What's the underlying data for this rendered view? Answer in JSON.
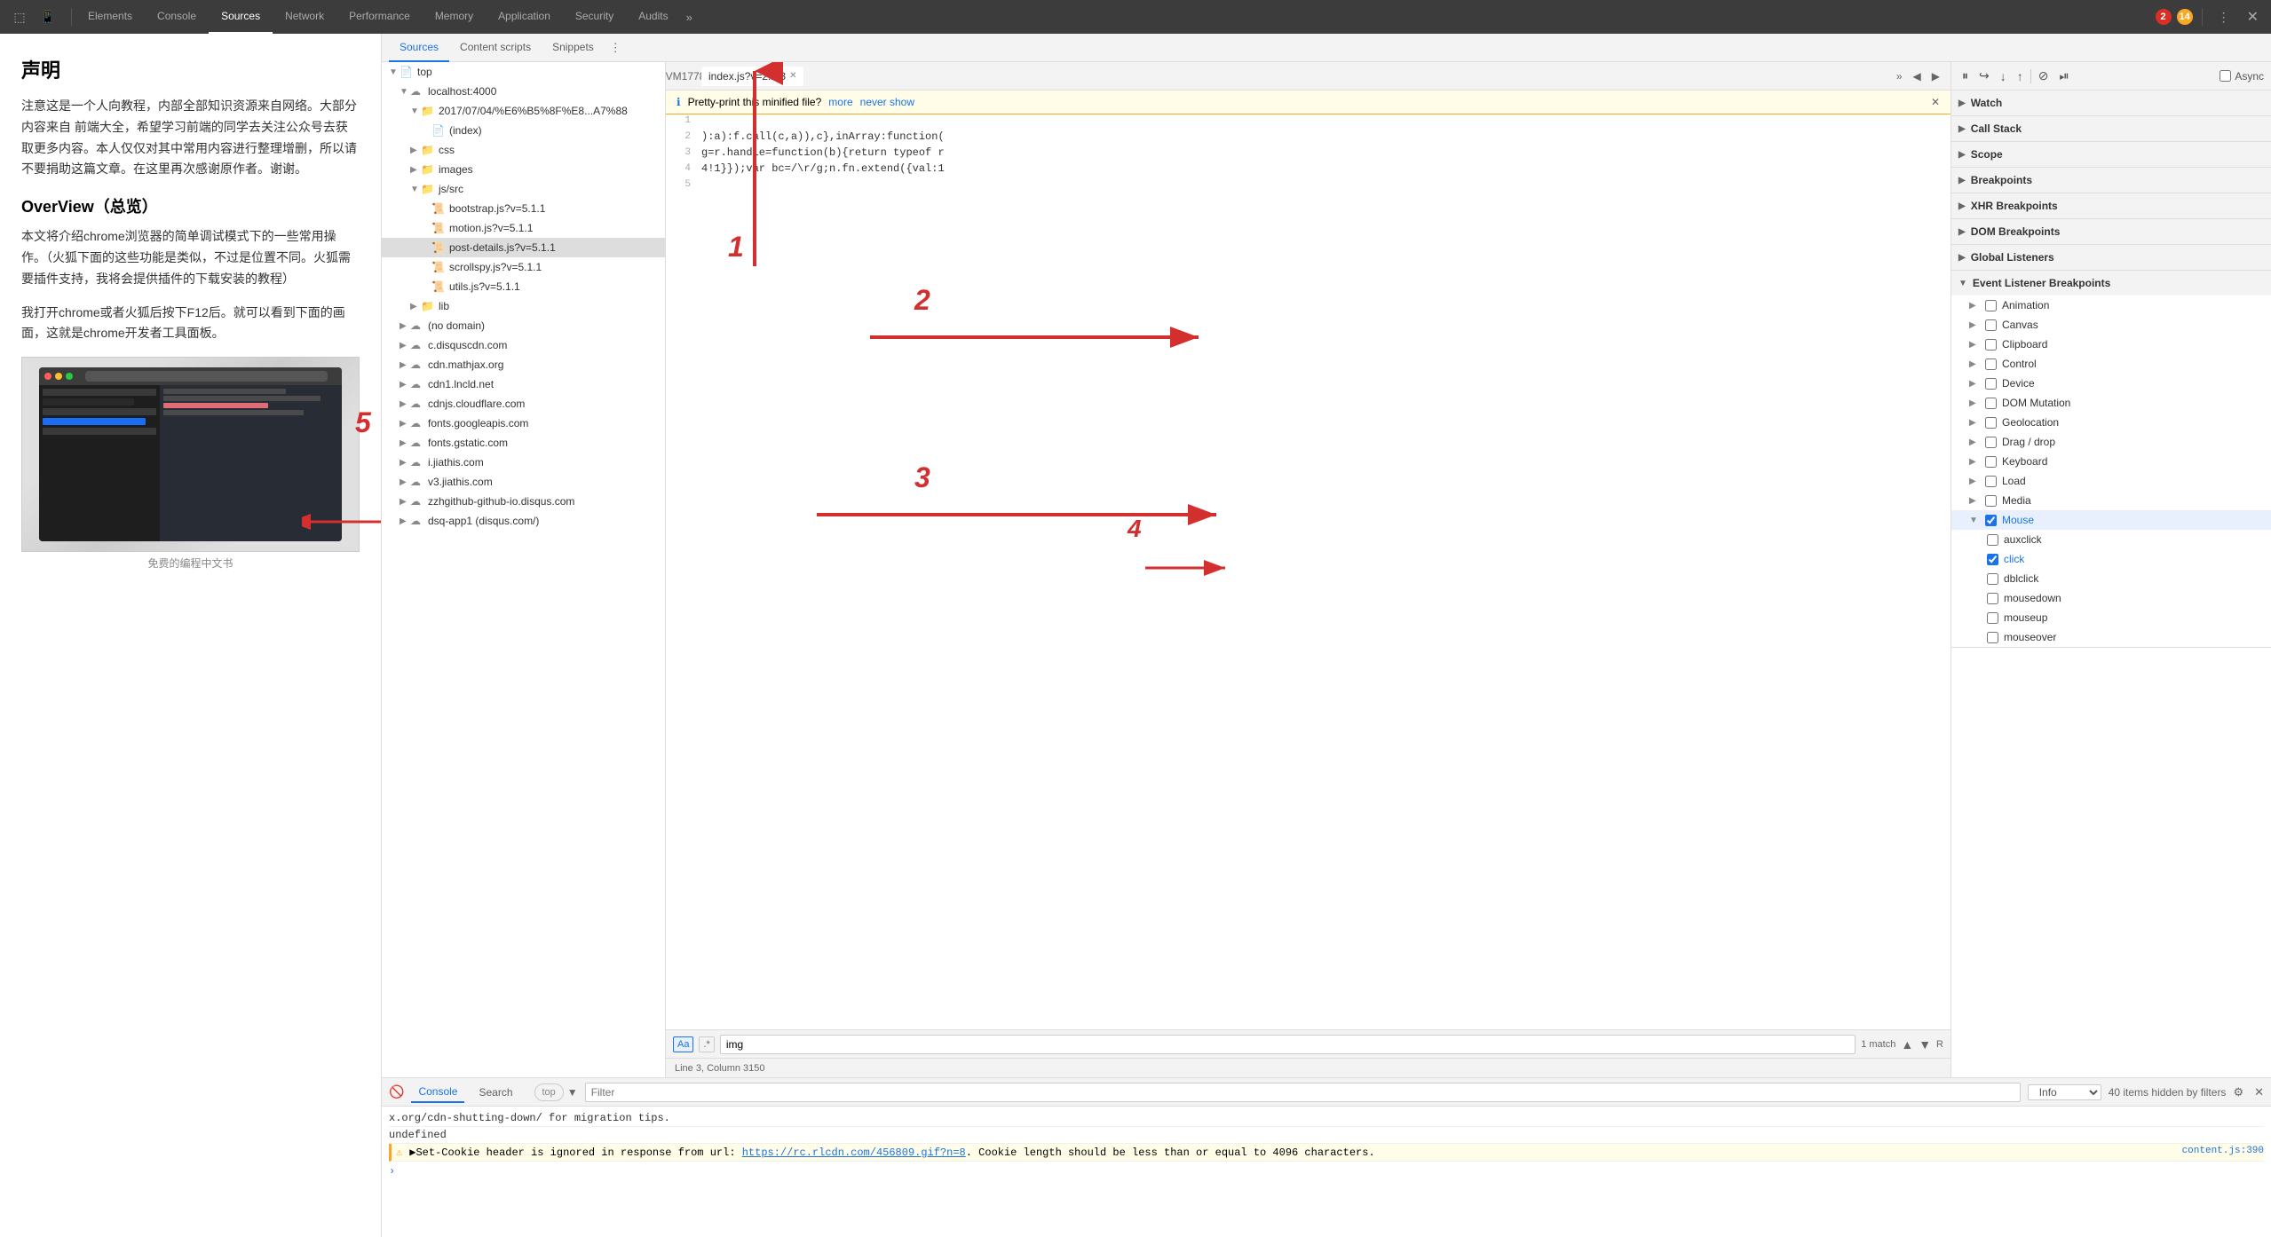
{
  "topbar": {
    "tabs": [
      {
        "label": "Elements",
        "active": false
      },
      {
        "label": "Console",
        "active": false
      },
      {
        "label": "Sources",
        "active": true
      },
      {
        "label": "Network",
        "active": false
      },
      {
        "label": "Performance",
        "active": false
      },
      {
        "label": "Memory",
        "active": false
      },
      {
        "label": "Application",
        "active": false
      },
      {
        "label": "Security",
        "active": false
      },
      {
        "label": "Audits",
        "active": false
      }
    ],
    "error_count": "2",
    "warning_count": "14",
    "more_label": "⋮"
  },
  "devtools_tabs": {
    "sources_tab": "Sources",
    "content_scripts_tab": "Content scripts",
    "snippets_tab": "Snippets",
    "more": "⋮"
  },
  "file_tree": {
    "root": "top",
    "items": [
      {
        "label": "top",
        "type": "root",
        "indent": 0,
        "expanded": true
      },
      {
        "label": "localhost:4000",
        "type": "cloud",
        "indent": 1,
        "expanded": true
      },
      {
        "label": "2017/07/04/%E6%B5%8F%E8...A7%88",
        "type": "folder",
        "indent": 2,
        "expanded": true
      },
      {
        "label": "(index)",
        "type": "file",
        "indent": 3,
        "expanded": false
      },
      {
        "label": "css",
        "type": "folder",
        "indent": 2,
        "expanded": false
      },
      {
        "label": "images",
        "type": "folder",
        "indent": 2,
        "expanded": false
      },
      {
        "label": "js/src",
        "type": "folder",
        "indent": 2,
        "expanded": true
      },
      {
        "label": "bootstrap.js?v=5.1.1",
        "type": "jsfile",
        "indent": 3,
        "expanded": false
      },
      {
        "label": "motion.js?v=5.1.1",
        "type": "jsfile",
        "indent": 3,
        "expanded": false
      },
      {
        "label": "post-details.js?v=5.1.1",
        "type": "jsfile",
        "indent": 3,
        "expanded": false,
        "selected": true
      },
      {
        "label": "scrollspy.js?v=5.1.1",
        "type": "jsfile",
        "indent": 3,
        "expanded": false
      },
      {
        "label": "utils.js?v=5.1.1",
        "type": "jsfile",
        "indent": 3,
        "expanded": false
      },
      {
        "label": "lib",
        "type": "folder",
        "indent": 2,
        "expanded": false
      },
      {
        "label": "(no domain)",
        "type": "cloud",
        "indent": 1,
        "expanded": false
      },
      {
        "label": "c.disquscdn.com",
        "type": "cloud",
        "indent": 1,
        "expanded": false
      },
      {
        "label": "cdn.mathjax.org",
        "type": "cloud",
        "indent": 1,
        "expanded": false
      },
      {
        "label": "cdn1.lncld.net",
        "type": "cloud",
        "indent": 1,
        "expanded": false
      },
      {
        "label": "cdnjs.cloudflare.com",
        "type": "cloud",
        "indent": 1,
        "expanded": false
      },
      {
        "label": "fonts.googleapis.com",
        "type": "cloud",
        "indent": 1,
        "expanded": false
      },
      {
        "label": "fonts.gstatic.com",
        "type": "cloud",
        "indent": 1,
        "expanded": false
      },
      {
        "label": "i.jiathis.com",
        "type": "cloud",
        "indent": 1,
        "expanded": false
      },
      {
        "label": "v3.jiathis.com",
        "type": "cloud",
        "indent": 1,
        "expanded": false
      },
      {
        "label": "zzhgithub-github-io.disqus.com",
        "type": "cloud",
        "indent": 1,
        "expanded": false
      },
      {
        "label": "dsq-app1 (disqus.com/)",
        "type": "cloud",
        "indent": 1,
        "expanded": false
      }
    ]
  },
  "code_panel": {
    "tab_label": "index.js?v=2.1.3",
    "pretty_print_msg": "Pretty-print this minified file?",
    "more_link": "more",
    "never_show_link": "never show",
    "lines": [
      {
        "num": "1",
        "content": ""
      },
      {
        "num": "2",
        "content": "):a):f.call(c,a)),c},inArray:function("
      },
      {
        "num": "3",
        "content": "g=r.handle=function(b){return typeof r"
      },
      {
        "num": "4",
        "content": "4!1}});var bc=/\\r/g;n.fn.extend({val:1"
      },
      {
        "num": "5",
        "content": ""
      }
    ],
    "search_placeholder": "img",
    "search_match": "1 match",
    "status": "Line 3, Column 3150"
  },
  "debugger": {
    "async_label": "Async",
    "sections": {
      "watch": "Watch",
      "call_stack": "Call Stack",
      "scope": "Scope",
      "breakpoints": "Breakpoints",
      "xhr_breakpoints": "XHR Breakpoints",
      "dom_breakpoints": "DOM Breakpoints",
      "global_listeners": "Global Listeners",
      "event_listener": "Event Listener Breakpoints"
    },
    "event_items": [
      {
        "label": "Animation",
        "checked": false,
        "expanded": false
      },
      {
        "label": "Canvas",
        "checked": false,
        "expanded": false
      },
      {
        "label": "Clipboard",
        "checked": false,
        "expanded": false
      },
      {
        "label": "Control",
        "checked": false,
        "expanded": false
      },
      {
        "label": "Device",
        "checked": false,
        "expanded": false
      },
      {
        "label": "DOM Mutation",
        "checked": false,
        "expanded": false
      },
      {
        "label": "Geolocation",
        "checked": false,
        "expanded": false
      },
      {
        "label": "Drag / drop",
        "checked": false,
        "expanded": false
      },
      {
        "label": "Keyboard",
        "checked": false,
        "expanded": false
      },
      {
        "label": "Load",
        "checked": false,
        "expanded": false
      },
      {
        "label": "Media",
        "checked": false,
        "expanded": false
      },
      {
        "label": "Mouse",
        "checked": false,
        "expanded": true,
        "blue": true
      }
    ],
    "mouse_sub_items": [
      {
        "label": "auxclick",
        "checked": false
      },
      {
        "label": "click",
        "checked": true
      },
      {
        "label": "dblclick",
        "checked": false
      },
      {
        "label": "mousedown",
        "checked": false
      },
      {
        "label": "mouseup",
        "checked": false
      },
      {
        "label": "mouseover",
        "checked": false
      }
    ]
  },
  "console": {
    "tabs": [
      {
        "label": "Console",
        "active": true
      },
      {
        "label": "Search",
        "active": false
      }
    ],
    "filter_placeholder": "Filter",
    "level": "Info",
    "hidden_msg": "40 items hidden by filters",
    "lines": [
      {
        "text": "x.org/cdn-shutting-down/ for migration tips.",
        "type": "info"
      },
      {
        "text": "undefined",
        "type": "info"
      },
      {
        "text": "▲ ▶Set-Cookie header is ignored in response from url: https://rc.rlcdn.com/456809.gif?n=8. Cookie length should be less than or equal to 4096 characters.",
        "type": "warning",
        "loc": "content.js:390"
      }
    ],
    "top_label": "top"
  },
  "article": {
    "title": "声明",
    "para1": "注意这是一个人向教程，内部全部知识资源来自网络。大部分内容来自 前端大全，希望学习前端的同学去关注公众号去获取更多内容。本人仅仅对其中常用内容进行整理增删，所以请不要捐助这篇文章。在这里再次感谢原作者。谢谢。",
    "heading2": "OverView（总览）",
    "para2": "本文将介绍chrome浏览器的简单调试模式下的一些常用操作。（火狐下面的这些功能是类似，不过是位置不同。火狐需要插件支持，我将会提供插件的下载安装的教程）",
    "para3": "我打开chrome或者火狐后按下F12后。就可以看到下面的画面，这就是chrome开发者工具面板。",
    "caption": "免费的编程中文书"
  },
  "annotations": {
    "num1": "1",
    "num2": "2",
    "num3": "3",
    "num4": "4",
    "num5": "5"
  }
}
